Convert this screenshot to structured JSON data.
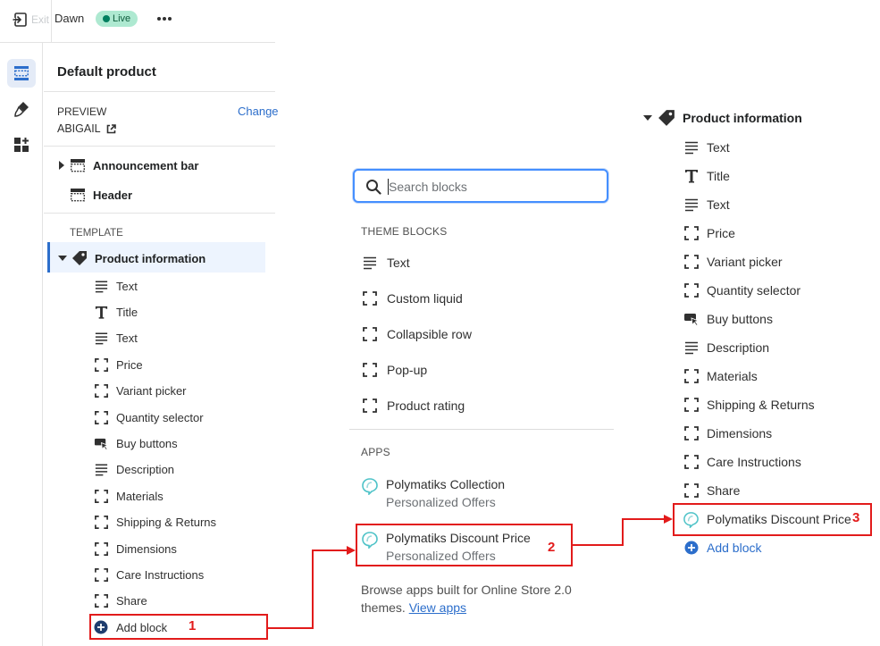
{
  "topbar": {
    "exit_label": "Exit",
    "theme_name": "Dawn",
    "live_badge": "Live",
    "more_icon": "horizontal-dots-icon"
  },
  "rail": {
    "items": [
      {
        "name": "sections-icon",
        "active": true
      },
      {
        "name": "theme-settings-brush-icon",
        "active": false
      },
      {
        "name": "app-embeds-icon",
        "active": false
      }
    ]
  },
  "left_panel": {
    "page_title": "Default product",
    "preview_heading": "PREVIEW",
    "preview_value": "ABIGAIL",
    "change_link": "Change",
    "header_sections": [
      "Announcement bar",
      "Header"
    ],
    "template_heading": "TEMPLATE",
    "section_title": "Product information",
    "blocks": [
      {
        "label": "Text",
        "icon": "text-lines-icon"
      },
      {
        "label": "Title",
        "icon": "title-t-icon"
      },
      {
        "label": "Text",
        "icon": "text-lines-icon"
      },
      {
        "label": "Price",
        "icon": "block-dashed-icon"
      },
      {
        "label": "Variant picker",
        "icon": "block-dashed-icon"
      },
      {
        "label": "Quantity selector",
        "icon": "block-dashed-icon"
      },
      {
        "label": "Buy buttons",
        "icon": "buy-buttons-icon"
      },
      {
        "label": "Description",
        "icon": "text-lines-icon"
      },
      {
        "label": "Materials",
        "icon": "block-dashed-icon"
      },
      {
        "label": "Shipping & Returns",
        "icon": "block-dashed-icon"
      },
      {
        "label": "Dimensions",
        "icon": "block-dashed-icon"
      },
      {
        "label": "Care Instructions",
        "icon": "block-dashed-icon"
      },
      {
        "label": "Share",
        "icon": "block-dashed-icon"
      }
    ],
    "add_block": "Add block"
  },
  "popup": {
    "search_placeholder": "Search blocks",
    "theme_blocks_heading": "THEME BLOCKS",
    "theme_blocks": [
      {
        "label": "Text",
        "icon": "text-lines-icon"
      },
      {
        "label": "Custom liquid",
        "icon": "block-dashed-icon"
      },
      {
        "label": "Collapsible row",
        "icon": "block-dashed-icon"
      },
      {
        "label": "Pop-up",
        "icon": "block-dashed-icon"
      },
      {
        "label": "Product rating",
        "icon": "block-dashed-icon"
      }
    ],
    "apps_heading": "APPS",
    "apps": [
      {
        "name": "Polymatiks Collection",
        "sub": "Personalized Offers"
      },
      {
        "name": "Polymatiks Discount Price",
        "sub": "Personalized Offers"
      }
    ],
    "browse_text": "Browse apps built for Online Store 2.0",
    "browse_text2": "themes.",
    "view_apps": "View apps"
  },
  "right_tree": {
    "section_title": "Product information",
    "blocks": [
      {
        "label": "Text",
        "icon": "text-lines-icon"
      },
      {
        "label": "Title",
        "icon": "title-t-icon"
      },
      {
        "label": "Text",
        "icon": "text-lines-icon"
      },
      {
        "label": "Price",
        "icon": "block-dashed-icon"
      },
      {
        "label": "Variant picker",
        "icon": "block-dashed-icon"
      },
      {
        "label": "Quantity selector",
        "icon": "block-dashed-icon"
      },
      {
        "label": "Buy buttons",
        "icon": "buy-buttons-icon"
      },
      {
        "label": "Description",
        "icon": "text-lines-icon"
      },
      {
        "label": "Materials",
        "icon": "block-dashed-icon"
      },
      {
        "label": "Shipping & Returns",
        "icon": "block-dashed-icon"
      },
      {
        "label": "Dimensions",
        "icon": "block-dashed-icon"
      },
      {
        "label": "Care Instructions",
        "icon": "block-dashed-icon"
      },
      {
        "label": "Share",
        "icon": "block-dashed-icon"
      }
    ],
    "app_block": "Polymatiks Discount Price",
    "add_block": "Add block"
  },
  "annotations": {
    "step1": "1",
    "step2": "2",
    "step3": "3",
    "color": "#e21b1b"
  },
  "colors": {
    "accent": "#2c6ecb",
    "live_badge_bg": "#aee9d1",
    "app_icon": "#4fc3c8"
  }
}
